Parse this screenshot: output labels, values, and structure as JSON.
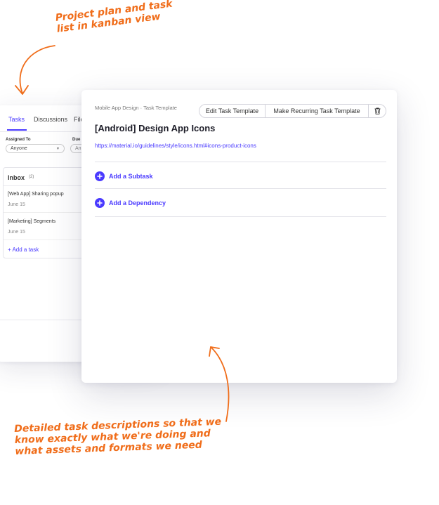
{
  "kanban": {
    "tabs": [
      "Tasks",
      "Discussions",
      "File"
    ],
    "filters": {
      "assigned_label": "Assigned To",
      "assigned_value": "Anyone",
      "due_label": "Due",
      "due_value": "An"
    },
    "column": {
      "title": "Inbox",
      "count": "(2)",
      "tasks": [
        {
          "title": "[Web App] Sharing popup",
          "date": "June 15"
        },
        {
          "title": "[Marketing] Segments",
          "date": "June 15"
        }
      ],
      "add_label": "+ Add a task"
    }
  },
  "modal": {
    "breadcrumb": "Mobile App Design · Task Template",
    "buttons": {
      "edit": "Edit Task Template",
      "recurring": "Make Recurring Task Template"
    },
    "title": "[Android] Design App Icons",
    "link": "https://material.io/guidelines/style/icons.html#icons-product-icons",
    "actions": {
      "subtask": "Add a Subtask",
      "dependency": "Add a Dependency"
    }
  },
  "annotations": {
    "top": [
      "Project plan and task",
      "list in kanban view"
    ],
    "bottom": [
      "Detailed task descriptions so that we",
      "know exactly what we're doing and",
      "what assets and formats we need"
    ]
  },
  "colors": {
    "accent": "#4a3aff",
    "annotation": "#f06d1a"
  }
}
